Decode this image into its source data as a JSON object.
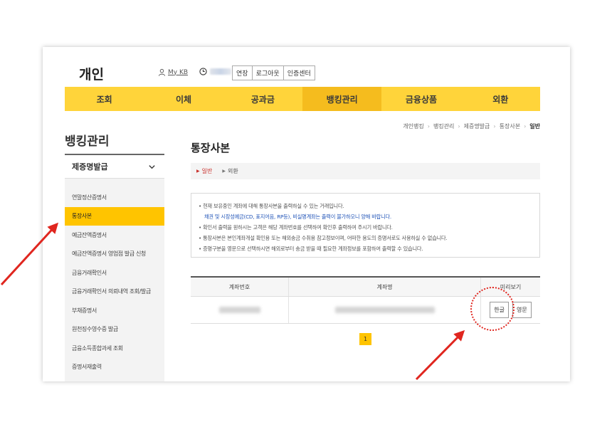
{
  "header": {
    "brand": "개인",
    "mykb": "My KB",
    "buttons": [
      "연장",
      "로그아웃",
      "인증센터"
    ]
  },
  "gnb": {
    "items": [
      "조회",
      "이체",
      "공과금",
      "뱅킹관리",
      "금융상품",
      "외환"
    ],
    "active_index": 3
  },
  "sidebar": {
    "title": "뱅킹관리",
    "category": "제증명발급",
    "items": [
      "연말정산증명서",
      "통장사본",
      "예금잔액증명서",
      "예금잔액증명서 영업점 발급 신청",
      "금융거래확인서",
      "금융거래확인서 의뢰내역 조회/발급",
      "부채증명서",
      "원천징수영수증 발급",
      "금융소득종합과세 조회",
      "증명서재출력"
    ],
    "active_index": 1
  },
  "location": [
    "개인뱅킹",
    "뱅킹관리",
    "제증명발급",
    "통장사본",
    "일반"
  ],
  "main": {
    "title": "통장사본",
    "tabs": [
      "일반",
      "외환"
    ],
    "notice": [
      "현재 보유중인 계좌에 대해 통장사본을 출력하실 수 있는 거래입니다.",
      "채권 및 시장성예금(CD, 표지어음, RP등), 비실명계좌는 출력이 불가하오니 양해 바랍니다.",
      "확인서 출력을 원하시는 고객은 해당 계좌번호를 선택하여 확인후 출력하여 주시기 바랍니다.",
      "통장사본은 본인계좌개설 확인용 또는 해외송금 수취용 참고정보이며, 어떠한 용도의 증명서로도 사용하실 수 없습니다.",
      "증명구분을 영문으로 선택하시면 해외로부터 송금 받을 때 필요한 계좌정보를 포함하여 출력할 수 있습니다."
    ],
    "table": {
      "headers": [
        "계좌번호",
        "계좌명",
        "미리보기"
      ],
      "buttons": [
        "한글",
        "영문"
      ]
    },
    "page": "1"
  },
  "colors": {
    "accent": "#ffd43a",
    "accent_active": "#f5bc1e",
    "highlight": "#ffc400",
    "annotation": "#e0261f",
    "link_blue": "#2255b8"
  }
}
